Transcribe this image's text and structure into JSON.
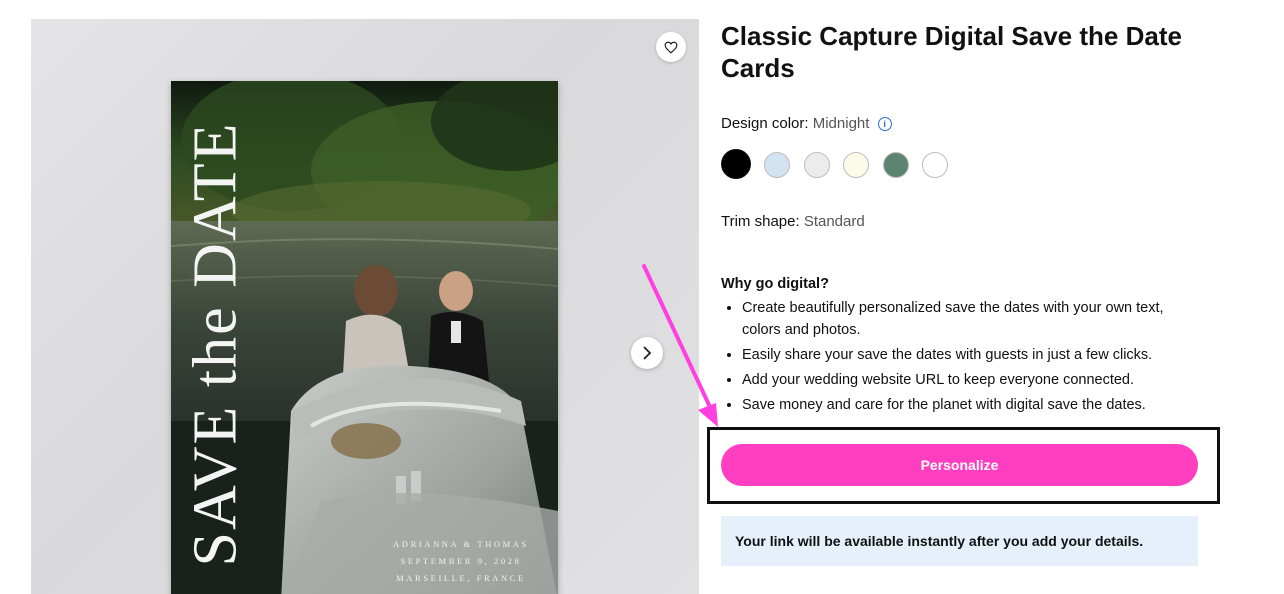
{
  "product": {
    "title": "Classic Capture Digital Save the Date Cards"
  },
  "design_color": {
    "label": "Design color:",
    "value": "Midnight",
    "info_icon": "info-icon",
    "swatches": [
      {
        "name": "Midnight",
        "color": "#000000",
        "selected": true
      },
      {
        "name": "light-blue",
        "color": "#d3e3f2",
        "selected": false
      },
      {
        "name": "light-gray",
        "color": "#ececec",
        "selected": false
      },
      {
        "name": "cream",
        "color": "#fbfbe9",
        "selected": false
      },
      {
        "name": "green",
        "color": "#5d8371",
        "selected": false
      },
      {
        "name": "white",
        "color": "#ffffff",
        "selected": false
      }
    ]
  },
  "trim": {
    "label": "Trim shape:",
    "value": "Standard"
  },
  "why_digital": {
    "heading": "Why go digital?",
    "bullets": [
      "Create beautifully personalized save the dates with your own text, colors and photos.",
      "Easily share your save the dates with guests in just a few clicks.",
      "Add your wedding website URL to keep everyone connected.",
      "Save money and care for the planet with digital save the dates."
    ]
  },
  "cta": {
    "personalize_label": "Personalize",
    "color": "#ff3fbf"
  },
  "notice": {
    "text": "Your link will be available instantly after you add your details."
  },
  "gallery": {
    "favorite_icon": "heart-icon",
    "next_icon": "chevron-right-icon",
    "card": {
      "vertical_text": "SAVE the DATE",
      "names": "ADRIANNA & THOMAS",
      "date": "SEPTEMBER 9, 2028",
      "location": "MARSEILLE, FRANCE"
    }
  },
  "annotation": {
    "arrow_color": "#ff3fe0",
    "box_color": "#111111"
  }
}
